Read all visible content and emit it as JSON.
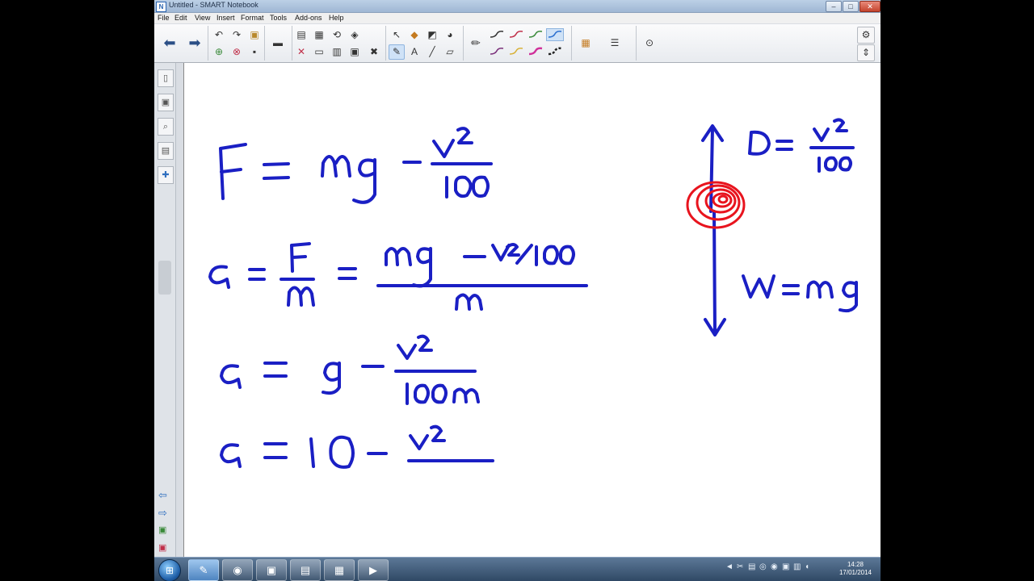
{
  "window": {
    "title": "Untitled - SMART Notebook",
    "app_icon": "notebook-icon",
    "minimize": "–",
    "maximize": "□",
    "close": "✕"
  },
  "menu": [
    "File",
    "Edit",
    "View",
    "Insert",
    "Format",
    "Tools",
    "Add-ons",
    "Help"
  ],
  "toolbar": {
    "back_glyph": "⬅",
    "forward_glyph": "➡",
    "icons": [
      "undo-icon",
      "redo-icon",
      "open-file-icon",
      "add-page-icon",
      "delete-page-icon",
      "save-icon",
      "screen-shade-icon",
      "paste-icon",
      "screen-capture-icon",
      "document-camera-icon",
      "select-icon",
      "table-icon",
      "fill-icon",
      "eraser-icon",
      "shapes-icon",
      "text-icon",
      "line-icon",
      "magic-pen-icon",
      "pen-icon",
      "properties-icon",
      "align-icon",
      "gear-icon",
      "move-toolbar-icon"
    ],
    "pen_colors": [
      "#333333",
      "#c0304a",
      "#3a8a3a",
      "#2a6fd0",
      "#7a2f7a",
      "#d8b23a",
      "#d0309a",
      "#222222"
    ],
    "accent": "#cfe2f7"
  },
  "ink": {
    "color": "#1a1fc4",
    "line1": "F = mg − v²/100",
    "line2": "a = F/m = (mg − v²/100) / m",
    "line3": "a = g − v²/100m",
    "line4": "a = 10 − v²",
    "diagram_drag": "D = v²/100",
    "diagram_weight": "W = mg",
    "ball_color": "#e8141e"
  },
  "taskbar": {
    "apps": [
      "smart-notebook-icon",
      "chrome-icon",
      "photo-viewer-icon",
      "folder-icon",
      "excel-icon",
      "media-icon"
    ],
    "time": "14:28",
    "date": "17/01/2014"
  }
}
